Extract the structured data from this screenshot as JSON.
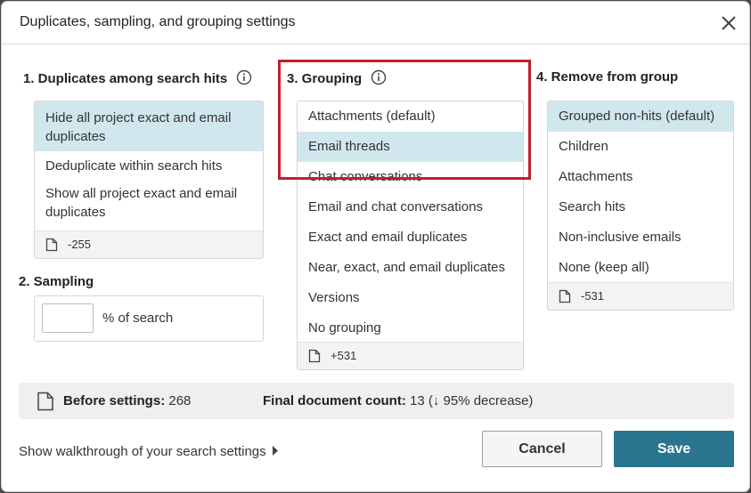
{
  "dialog": {
    "title": "Duplicates, sampling, and grouping settings",
    "close_icon": "close-icon"
  },
  "duplicates": {
    "title": "1. Duplicates among search hits",
    "options": [
      {
        "label": "Hide all project exact and email duplicates",
        "selected": true
      },
      {
        "label": "Deduplicate within search hits",
        "selected": false
      },
      {
        "label": "Show all project exact and email duplicates",
        "selected": false
      }
    ],
    "footer_count": "-255"
  },
  "sampling": {
    "title": "2. Sampling",
    "input_value": "",
    "suffix": "% of search"
  },
  "grouping": {
    "title": "3. Grouping",
    "options": [
      {
        "label": "Attachments (default)",
        "selected": false
      },
      {
        "label": "Email threads",
        "selected": true
      },
      {
        "label": "Chat conversations",
        "selected": false
      },
      {
        "label": "Email and chat conversations",
        "selected": false
      },
      {
        "label": "Exact and email duplicates",
        "selected": false
      },
      {
        "label": "Near, exact, and email duplicates",
        "selected": false
      },
      {
        "label": "Versions",
        "selected": false
      },
      {
        "label": "No grouping",
        "selected": false
      }
    ],
    "footer_count": "+531"
  },
  "remove": {
    "title": "4. Remove from group",
    "options": [
      {
        "label": "Grouped non-hits (default)",
        "selected": true
      },
      {
        "label": "Children",
        "selected": false
      },
      {
        "label": "Attachments",
        "selected": false
      },
      {
        "label": "Search hits",
        "selected": false
      },
      {
        "label": "Non-inclusive emails",
        "selected": false
      },
      {
        "label": "None (keep all)",
        "selected": false
      }
    ],
    "footer_count": "-531"
  },
  "summary": {
    "before_label": "Before settings:",
    "before_value": "268",
    "final_label": "Final document count:",
    "final_value": "13 (↓ 95% decrease)"
  },
  "footer": {
    "walkthrough_label": "Show walkthrough of your search settings",
    "cancel_label": "Cancel",
    "save_label": "Save"
  },
  "colors": {
    "selected_bg": "#d1e7ee",
    "primary": "#2a7590",
    "highlight": "#c0202f"
  }
}
